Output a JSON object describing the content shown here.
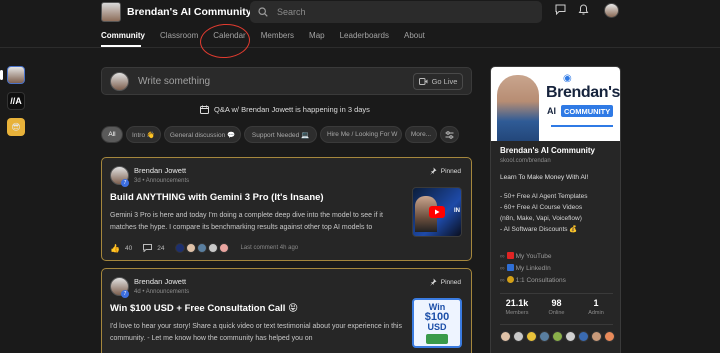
{
  "header": {
    "community_name": "Brendan's AI Community",
    "search_placeholder": "Search"
  },
  "nav": {
    "tabs": [
      "Community",
      "Classroom",
      "Calendar",
      "Members",
      "Map",
      "Leaderboards",
      "About"
    ],
    "active_tab": "Community",
    "annotated_tab": "Calendar",
    "annotation_color": "#e13b2f"
  },
  "left_rail": {
    "items": [
      {
        "icon": "brendan-avatar-icon"
      },
      {
        "label": "//A",
        "icon": "ai-logo-icon"
      },
      {
        "icon": "emoji-group-icon"
      }
    ]
  },
  "composer": {
    "placeholder": "Write something",
    "go_live_label": "Go Live"
  },
  "event_banner": {
    "text": "Q&A w/ Brendan Jowett is happening in 3 days"
  },
  "filters": {
    "chips": [
      "All",
      "Intro 👋",
      "General discussion 💬",
      "Support Needed 💻",
      "Hire Me / Looking For W",
      "More..."
    ],
    "active": "All"
  },
  "posts": [
    {
      "author": "Brendan Jowett",
      "level": "7",
      "meta": "3d • Announcements",
      "pinned_label": "Pinned",
      "title": "Build ANYTHING with Gemini 3 Pro (It's Insane)",
      "body": "Gemini 3 Pro is here and today I'm doing a complete deep dive into the model to see if it matches the hype. I compare its benchmarking results against other top AI models to",
      "likes": "40",
      "comments": "24",
      "last_comment": "Last comment 4h ago"
    },
    {
      "author": "Brendan Jowett",
      "level": "7",
      "meta": "4d • Announcements",
      "pinned_label": "Pinned",
      "title": "Win $100 USD + Free Consultation Call 😝",
      "body": "I'd love to hear your story! Share a quick video or text testimonial about your experience in this community. - Let me know how the community has helped you on",
      "thumb_line1": "Win",
      "thumb_line2": "$100",
      "thumb_line3": "USD"
    }
  ],
  "community_card": {
    "banner_title_1": "Brendan's",
    "banner_title_2": "AI",
    "banner_pill": "COMMUNITY",
    "name": "Brendan's AI Community",
    "url": "skool.com/brendan",
    "tagline": "Learn To Make Money With AI!",
    "bullets": [
      "- 50+ Free AI Agent Templates",
      "- 60+ Free AI Course Videos",
      "(n8n, Make, Vapi, Voiceflow)",
      "- AI Software Discounts 💰"
    ],
    "links": [
      {
        "label": "My YouTube",
        "color": "#e02424"
      },
      {
        "label": "My LinkedIn",
        "color": "#2f6fd6"
      },
      {
        "label": "1:1 Consultations",
        "color": "#d4a017"
      }
    ],
    "stats": [
      {
        "value": "21.1k",
        "label": "Members"
      },
      {
        "value": "98",
        "label": "Online"
      },
      {
        "value": "1",
        "label": "Admin"
      }
    ]
  }
}
